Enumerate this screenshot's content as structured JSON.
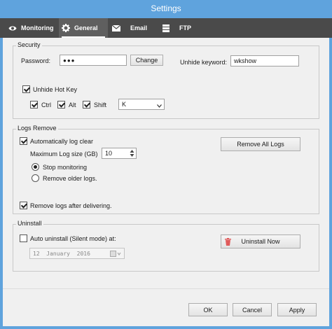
{
  "window": {
    "title": "Settings"
  },
  "tabs": [
    {
      "label": "Monitoring",
      "icon": "eye-icon"
    },
    {
      "label": "General",
      "icon": "gear-icon",
      "active": true
    },
    {
      "label": "Email",
      "icon": "envelope-icon"
    },
    {
      "label": "FTP",
      "icon": "server-icon"
    }
  ],
  "security": {
    "title": "Security",
    "password_label": "Password:",
    "password_value": "●●●",
    "change_button": "Change",
    "unhide_keyword_label": "Unhide keyword:",
    "unhide_keyword_value": "wkshow",
    "unhide_hotkey_label": "Unhide Hot Key",
    "unhide_hotkey_checked": true,
    "ctrl_label": "Ctrl",
    "ctrl_checked": true,
    "alt_label": "Alt",
    "alt_checked": true,
    "shift_label": "Shift",
    "shift_checked": true,
    "key_value": "K"
  },
  "logs_remove": {
    "title": "Logs Remove",
    "auto_clear_label": "Automatically log clear",
    "auto_clear_checked": true,
    "max_size_label": "Maximum Log size (GB)",
    "max_size_value": "10",
    "stop_monitoring_label": "Stop monitoring",
    "stop_monitoring_selected": true,
    "remove_older_label": "Remove older logs.",
    "remove_older_selected": false,
    "remove_all_button": "Remove All Logs",
    "remove_after_delivering_label": "Remove logs after delivering.",
    "remove_after_delivering_checked": true
  },
  "uninstall": {
    "title": "Uninstall",
    "auto_uninstall_label": "Auto uninstall (Silent mode) at:",
    "auto_uninstall_checked": false,
    "date_day": "12",
    "date_month": "January",
    "date_year": "2016",
    "uninstall_now_button": "Uninstall Now"
  },
  "footer": {
    "ok": "OK",
    "cancel": "Cancel",
    "apply": "Apply"
  },
  "colors": {
    "titlebar": "#5fa3dd",
    "tabbar": "#4a4a4a",
    "uninstall_icon": "#e05a5a"
  }
}
